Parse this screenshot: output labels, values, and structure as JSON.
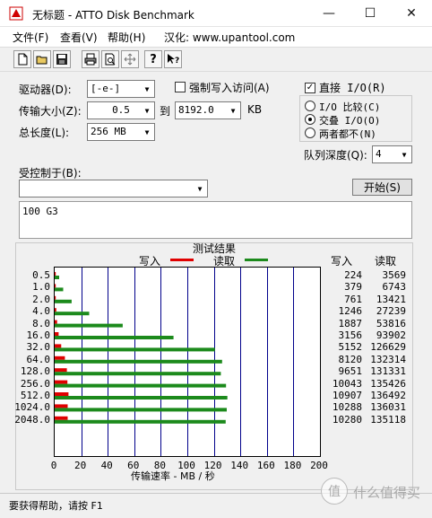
{
  "window": {
    "title": "无标题 - ATTO Disk Benchmark",
    "minimize_glyph": "—",
    "maximize_glyph": "☐",
    "close_glyph": "✕"
  },
  "menu": {
    "file": "文件(F)",
    "view": "查看(V)",
    "help": "帮助(H)",
    "localized": "汉化: www.upantool.com"
  },
  "toolbar": {
    "icons": [
      "new-file-icon",
      "open-folder-icon",
      "save-icon",
      "print-icon",
      "print-preview-icon",
      "move-icon",
      "help-icon",
      "context-help-icon"
    ]
  },
  "settings": {
    "drive_label": "驱动器(D):",
    "drive_value": "[-e-]",
    "force_write_label": "强制写入访问(A)",
    "transfer_size_label": "传输大小(Z):",
    "transfer_from": "0.5",
    "to_label": "到",
    "transfer_to": "8192.0",
    "kb_label": "KB",
    "total_length_label": "总长度(L):",
    "total_length_value": "256 MB",
    "direct_io_label": "直接 I/O(R)",
    "direct_io_checked": true,
    "radio_io_compare": "I/O 比较(C)",
    "radio_overlap": "交叠 I/O(O)",
    "radio_neither": "两者都不(N)",
    "selected_radio": "overlap",
    "queue_depth_label": "队列深度(Q):",
    "queue_depth_value": "4",
    "controlled_by_label": "受控制于(B):",
    "controlled_by_value": "",
    "start_button": "开始(S)",
    "description": "100 G3"
  },
  "results": {
    "title": "测试结果",
    "legend_write": "写入",
    "legend_read": "读取",
    "col_write": "写入",
    "col_read": "读取",
    "xlabel": "传输速率 - MB / 秒",
    "write_color": "#e00000",
    "read_color": "#1c8a1c"
  },
  "chart_data": {
    "type": "bar",
    "orientation": "horizontal",
    "categories": [
      "0.5",
      "1.0",
      "2.0",
      "4.0",
      "8.0",
      "16.0",
      "32.0",
      "64.0",
      "128.0",
      "256.0",
      "512.0",
      "1024.0",
      "2048.0"
    ],
    "x_ticks": [
      "0",
      "20",
      "40",
      "60",
      "80",
      "100",
      "120",
      "140",
      "160",
      "180",
      "200"
    ],
    "xlim": [
      0,
      200
    ],
    "grid": true,
    "series": [
      {
        "name": "写入",
        "values": [
          0.2,
          0.4,
          0.7,
          1.2,
          1.8,
          3.0,
          4.9,
          7.7,
          9.2,
          9.6,
          10.4,
          9.8,
          9.8
        ],
        "kb_values": [
          "224",
          "379",
          "761",
          "1246",
          "1887",
          "3156",
          "5152",
          "8120",
          "9651",
          "10043",
          "10907",
          "10288",
          "10280"
        ]
      },
      {
        "name": "读取",
        "values": [
          3.4,
          6.4,
          12.8,
          26.0,
          51.3,
          89.6,
          120.8,
          126.2,
          125.3,
          129.2,
          130.2,
          129.7,
          128.9
        ],
        "kb_values": [
          "3569",
          "6743",
          "13421",
          "27239",
          "53816",
          "93902",
          "126629",
          "132314",
          "131331",
          "135426",
          "136492",
          "136031",
          "135118"
        ]
      }
    ]
  },
  "status": {
    "text": "要获得帮助，请按 F1",
    "watermark": "什么值得买"
  }
}
